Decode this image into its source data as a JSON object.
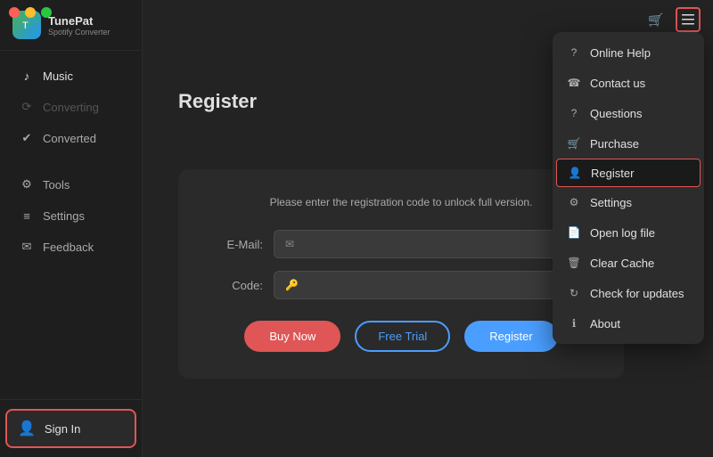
{
  "app": {
    "title": "TunePat",
    "subtitle": "Spotify Converter"
  },
  "traffic_lights": [
    "red",
    "yellow",
    "green"
  ],
  "sidebar": {
    "items": [
      {
        "id": "music",
        "label": "Music",
        "icon": "♪",
        "active": true,
        "disabled": false
      },
      {
        "id": "converting",
        "label": "Converting",
        "icon": "⟳",
        "active": false,
        "disabled": true
      },
      {
        "id": "converted",
        "label": "Converted",
        "icon": "☑",
        "active": false,
        "disabled": false
      }
    ],
    "tools_section": [
      {
        "id": "tools",
        "label": "Tools",
        "icon": "⚙"
      },
      {
        "id": "settings",
        "label": "Settings",
        "icon": "≡"
      },
      {
        "id": "feedback",
        "label": "Feedback",
        "icon": "✉"
      }
    ],
    "sign_in_label": "Sign In"
  },
  "topbar": {
    "cart_icon": "🛒",
    "menu_icon": "≡"
  },
  "register": {
    "title": "Register",
    "description": "Please enter the registration code to unlock full version.",
    "email_label": "E-Mail:",
    "email_placeholder": "",
    "code_label": "Code:",
    "code_placeholder": "",
    "buy_now_label": "Buy Now",
    "free_trial_label": "Free Trial",
    "register_label": "Register"
  },
  "dropdown": {
    "items": [
      {
        "id": "online-help",
        "label": "Online Help",
        "icon": "?"
      },
      {
        "id": "contact-us",
        "label": "Contact us",
        "icon": "☎"
      },
      {
        "id": "questions",
        "label": "Questions",
        "icon": "?"
      },
      {
        "id": "purchase",
        "label": "Purchase",
        "icon": "🛒"
      },
      {
        "id": "register",
        "label": "Register",
        "icon": "👤",
        "highlighted": true
      },
      {
        "id": "settings",
        "label": "Settings",
        "icon": "⚙"
      },
      {
        "id": "open-log",
        "label": "Open log file",
        "icon": "📄"
      },
      {
        "id": "clear-cache",
        "label": "Clear Cache",
        "icon": "🗑"
      },
      {
        "id": "check-updates",
        "label": "Check for updates",
        "icon": "↻"
      },
      {
        "id": "about",
        "label": "About",
        "icon": "ℹ"
      }
    ]
  }
}
